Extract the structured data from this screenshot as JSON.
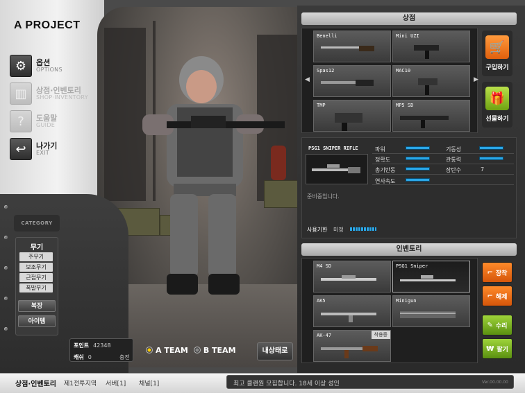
{
  "app": {
    "title": "A PROJECT"
  },
  "menu": [
    {
      "ko": "옵션",
      "en": "OPTIONS",
      "icon": "gear-icon",
      "enabled": true
    },
    {
      "ko": "상점·인벤토리",
      "en": "SHOP·INVENTORY",
      "icon": "shop-icon",
      "enabled": false
    },
    {
      "ko": "도움말",
      "en": "GUIDE",
      "icon": "help-icon",
      "enabled": false
    },
    {
      "ko": "나가기",
      "en": "EXIT",
      "icon": "exit-icon",
      "enabled": true
    }
  ],
  "category": {
    "label": "CATEGORY",
    "weapon": "무기",
    "subs": [
      "주무기",
      "보조무기",
      "근접무기",
      "폭발무기"
    ],
    "armor": "복장",
    "item": "아이템"
  },
  "points": {
    "label": "포인트",
    "value": "42348",
    "cash_label": "캐쉬",
    "cash_value": "0",
    "charge": "충전"
  },
  "teams": {
    "a": "A TEAM",
    "b": "B TEAM"
  },
  "status_button": "내상태로",
  "shop": {
    "title": "상점",
    "items": [
      "Benelli",
      "Mini UZI",
      "Spas12",
      "MAC10",
      "TMP",
      "MP5 SD"
    ],
    "buy": "구입하기",
    "gift": "선물하기"
  },
  "detail": {
    "name": "PSG1 SNIPER RIFLE",
    "stats": [
      {
        "label": "파워",
        "value": 0.7
      },
      {
        "label": "기동성",
        "value": 0.7
      },
      {
        "label": "정확도",
        "value": 0.7
      },
      {
        "label": "관통력",
        "value": 0.7
      },
      {
        "label": "총기반동",
        "value": 0.7
      },
      {
        "label": "장탄수",
        "text": "7"
      },
      {
        "label": "연사속도",
        "value": 0.7
      }
    ],
    "ready_text": "준비중입니다.",
    "period_label": "사용기한",
    "period_value": "미정"
  },
  "inventory": {
    "title": "인벤토리",
    "items": [
      {
        "name": "M4 SD",
        "badge": ""
      },
      {
        "name": "PSG1 Sniper",
        "badge": ""
      },
      {
        "name": "AK5",
        "badge": ""
      },
      {
        "name": "Minigun",
        "badge": ""
      },
      {
        "name": "AK-47",
        "badge": "착용중"
      }
    ],
    "equip": "장착",
    "release": "해제",
    "repair": "수리",
    "sell": "팔기"
  },
  "bottom": {
    "title": "상점·인벤토리",
    "items": [
      "제1전투지역",
      "서버[1]",
      "채널[1]"
    ],
    "notice": "최고 클랜원 모집합니다. 18세 이상 성인",
    "version": "Ver.00.00.00"
  },
  "colors": {
    "accent_orange": "#e0600d",
    "accent_green": "#6fa212",
    "stat_blue": "#2aa7e8"
  }
}
